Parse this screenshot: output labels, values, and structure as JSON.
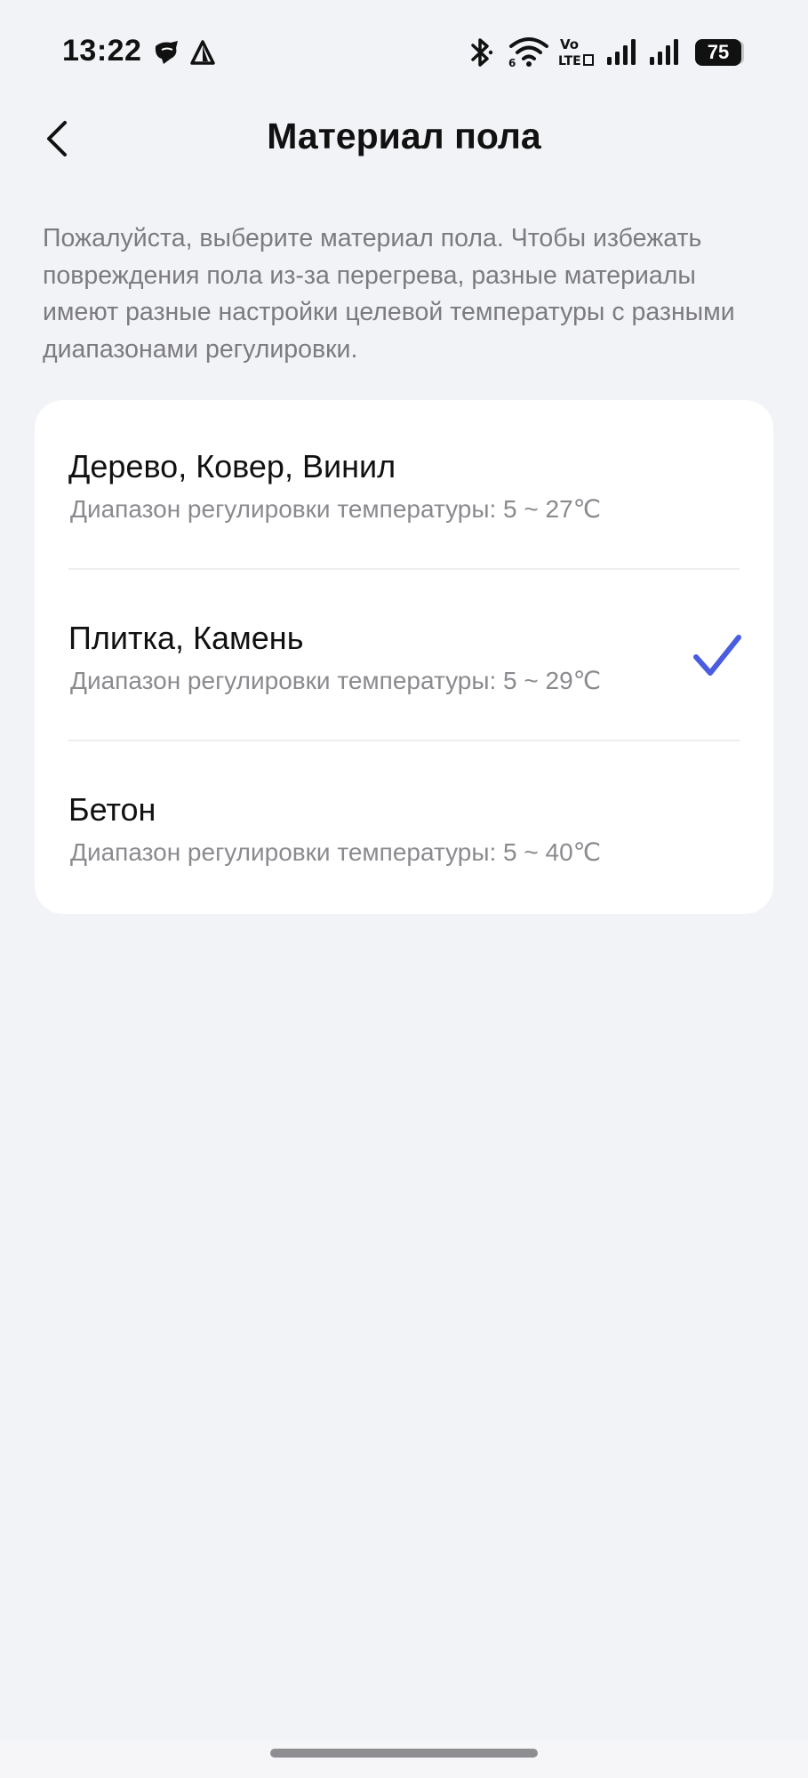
{
  "status_bar": {
    "time": "13:22",
    "battery_level": "75",
    "icons": [
      "notification-icon",
      "warning-triangle-icon",
      "bluetooth-icon",
      "wifi-6-icon",
      "volte-icon",
      "signal-icon",
      "signal-icon"
    ]
  },
  "header": {
    "title": "Материал пола",
    "back_icon": "chevron-left-icon"
  },
  "description": "Пожалуйста, выберите материал пола. Чтобы избежать повреждения пола из-за перегрева, разные материалы имеют разные настройки целевой температуры с разными диапазонами регулировки.",
  "options": [
    {
      "title": "Дерево, Ковер, Винил",
      "subtitle": "Диапазон регулировки температуры: 5 ~ 27℃",
      "selected": false
    },
    {
      "title": "Плитка, Камень",
      "subtitle": "Диапазон регулировки температуры: 5 ~ 29℃",
      "selected": true
    },
    {
      "title": "Бетон",
      "subtitle": "Диапазон регулировки температуры: 5 ~ 40℃",
      "selected": false
    }
  ],
  "colors": {
    "background": "#f2f3f7",
    "card": "#ffffff",
    "accent_check": "#4a5de0",
    "secondary_text": "#8a8a8f"
  }
}
